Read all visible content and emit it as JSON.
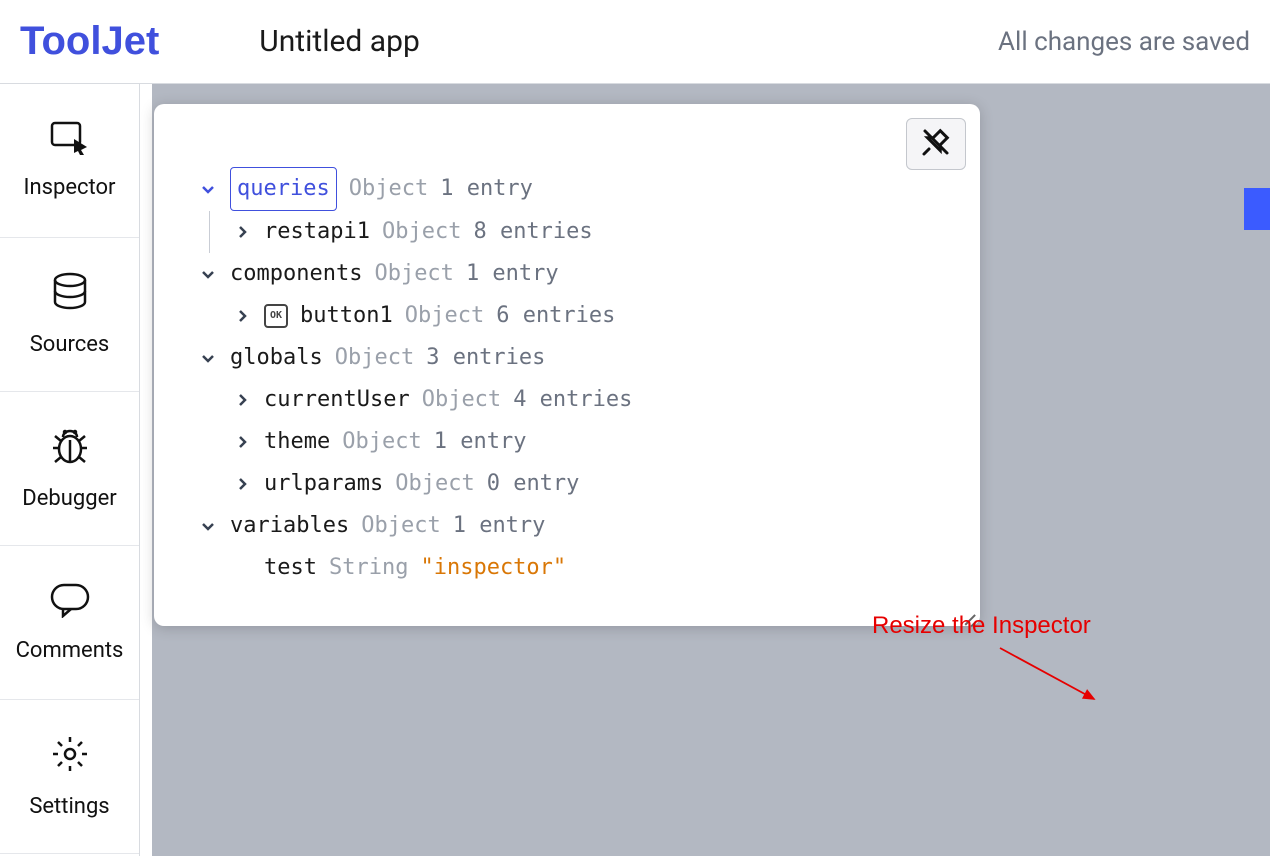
{
  "header": {
    "logo": "ToolJet",
    "app_title": "Untitled app",
    "save_status": "All changes are saved"
  },
  "sidebar": {
    "items": [
      {
        "label": "Inspector"
      },
      {
        "label": "Sources"
      },
      {
        "label": "Debugger"
      },
      {
        "label": "Comments"
      },
      {
        "label": "Settings"
      }
    ]
  },
  "inspector": {
    "type_label": "Object",
    "string_label": "String",
    "queries": {
      "name": "queries",
      "meta": "1 entry",
      "children": [
        {
          "name": "restapi1",
          "meta": "8 entries"
        }
      ]
    },
    "components": {
      "name": "components",
      "meta": "1 entry",
      "children": [
        {
          "name": "button1",
          "meta": "6 entries",
          "badge": "OK"
        }
      ]
    },
    "globals": {
      "name": "globals",
      "meta": "3 entries",
      "children": [
        {
          "name": "currentUser",
          "meta": "4 entries"
        },
        {
          "name": "theme",
          "meta": "1 entry"
        },
        {
          "name": "urlparams",
          "meta": "0 entry"
        }
      ]
    },
    "variables": {
      "name": "variables",
      "meta": "1 entry",
      "children": [
        {
          "name": "test",
          "value": "\"inspector\""
        }
      ]
    }
  },
  "annotation": "Resize the Inspector"
}
